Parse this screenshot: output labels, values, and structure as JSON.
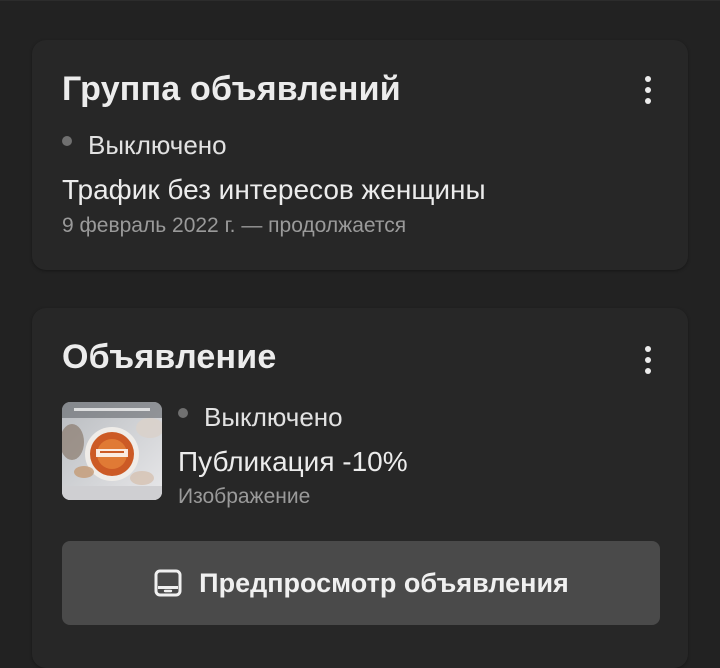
{
  "ad_group": {
    "title": "Группа объявлений",
    "status": "Выключено",
    "name": "Трафик без интересов женщины",
    "schedule": "9 февраль 2022 г. — продолжается"
  },
  "ad": {
    "title": "Объявление",
    "status": "Выключено",
    "name": "Публикация -10%",
    "format": "Изображение",
    "preview_button": "Предпросмотр объявления"
  },
  "colors": {
    "background": "#222222",
    "card": "#272727",
    "button": "#4a4a4a",
    "status_off_dot": "#707070"
  },
  "icons": {
    "menu": "more-vertical-icon",
    "preview": "tablet-device-icon"
  }
}
